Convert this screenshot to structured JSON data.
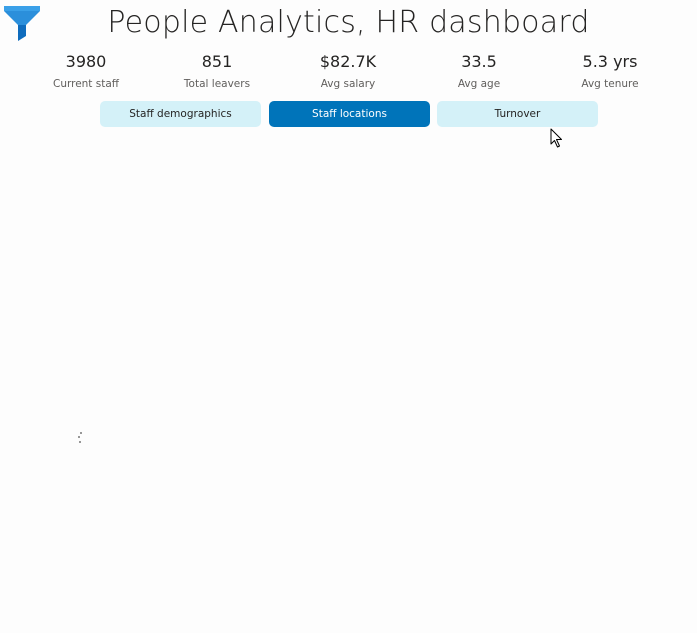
{
  "header": {
    "title": "People Analytics, HR dashboard",
    "filter_icon": "filter-funnel-icon"
  },
  "kpis": [
    {
      "value": "3980",
      "label": "Current staff"
    },
    {
      "value": "851",
      "label": "Total leavers"
    },
    {
      "value": "$82.7K",
      "label": "Avg salary"
    },
    {
      "value": "33.5",
      "label": "Avg age"
    },
    {
      "value": "5.3 yrs",
      "label": "Avg tenure"
    }
  ],
  "nav": {
    "buttons": [
      {
        "label": "Staff demographics",
        "active": false
      },
      {
        "label": "Staff locations",
        "active": true
      },
      {
        "label": "Turnover",
        "active": false
      }
    ]
  },
  "colors": {
    "accent": "#0074ba",
    "button_bg": "#d4f1f8",
    "filter_icon_light": "#3aa0e8",
    "filter_icon_dark": "#0f6cbd"
  },
  "status": {
    "loading_icon": "loading-spinner-icon"
  }
}
